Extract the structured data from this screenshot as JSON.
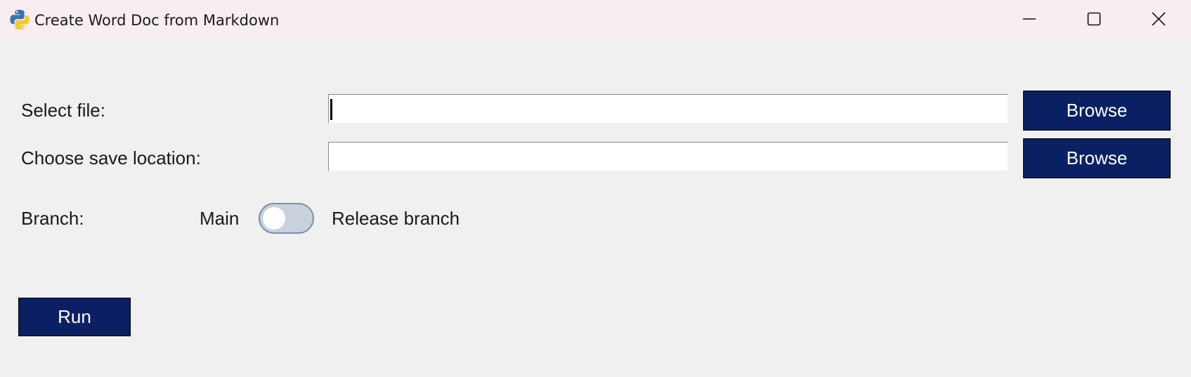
{
  "window": {
    "title": "Create Word Doc from Markdown"
  },
  "form": {
    "select_file_label": "Select file:",
    "select_file_value": "",
    "save_location_label": "Choose save location:",
    "save_location_value": "",
    "browse_file_label": "Browse",
    "browse_save_label": "Browse",
    "branch_label": "Branch:",
    "branch_left_option": "Main",
    "branch_right_option": "Release branch",
    "branch_toggle_on": false,
    "run_label": "Run"
  },
  "colors": {
    "button_bg": "#0a2063",
    "titlebar_bg": "#f8eef2",
    "window_bg": "#f0f0f0",
    "toggle_track": "#c9d1dd"
  },
  "icons": {
    "app": "python-icon",
    "minimize": "minimize-icon",
    "maximize": "maximize-icon",
    "close": "close-icon"
  }
}
